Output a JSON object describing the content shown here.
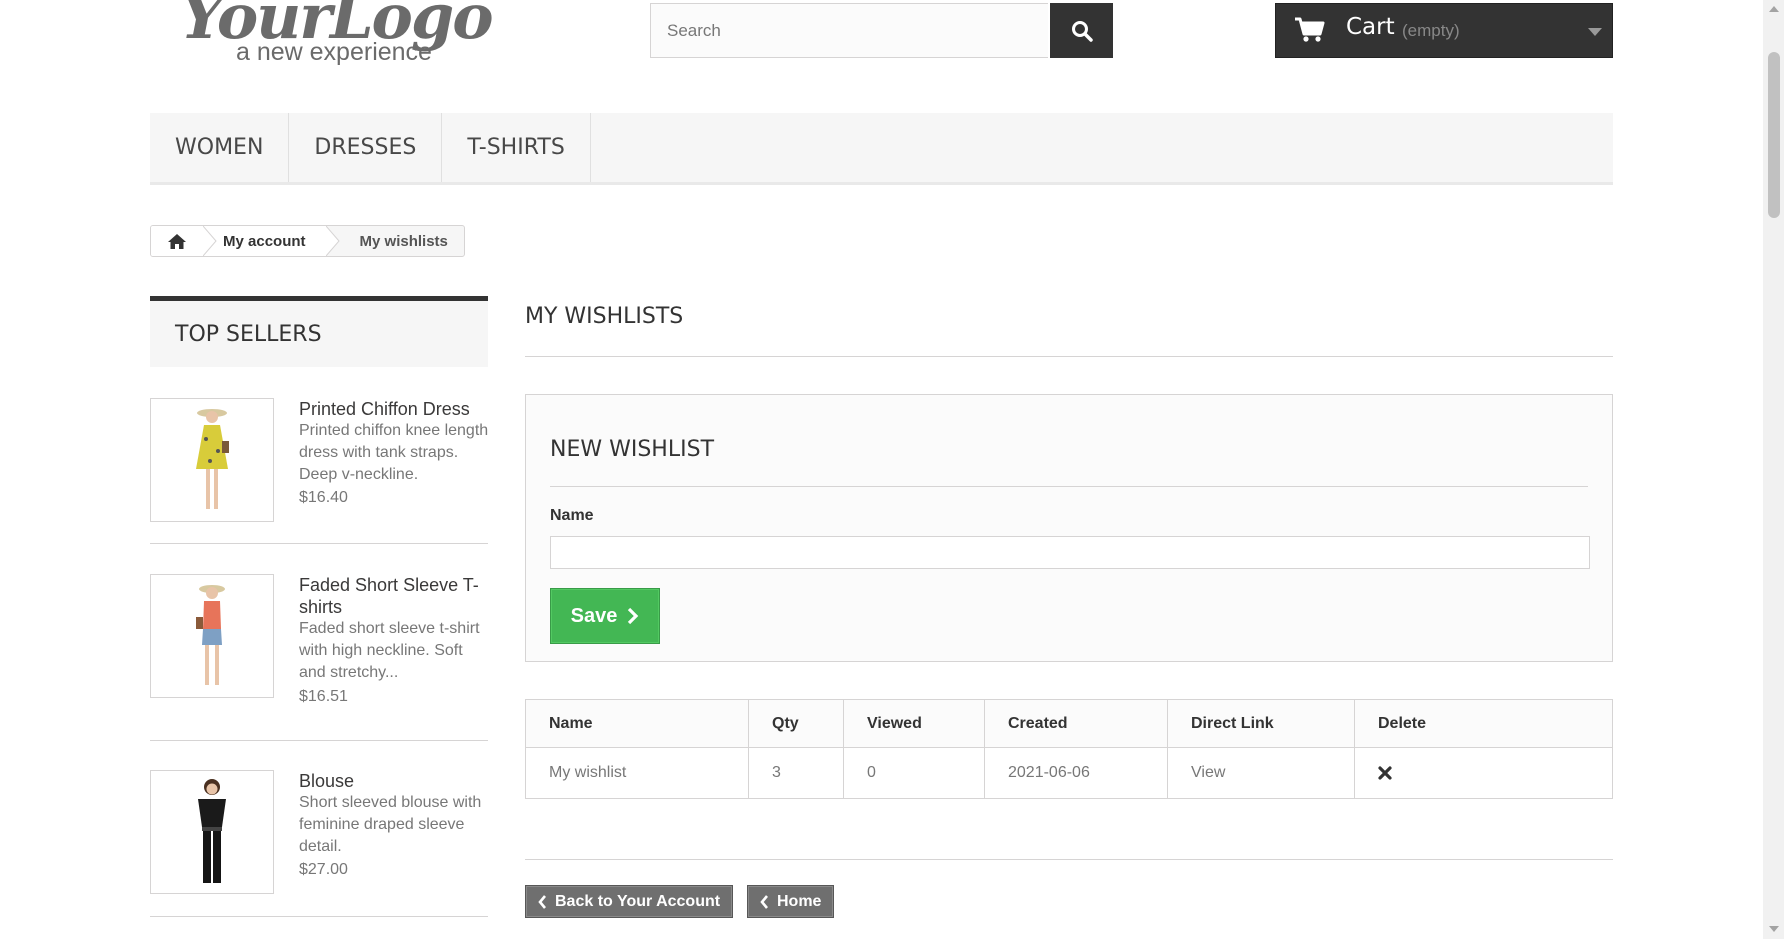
{
  "logo": {
    "main": "YourLogo",
    "tagline": "a new experience"
  },
  "search": {
    "placeholder": "Search",
    "value": ""
  },
  "cart": {
    "label": "Cart",
    "status": "(empty)"
  },
  "menu": {
    "items": [
      "WOMEN",
      "DRESSES",
      "T-SHIRTS"
    ]
  },
  "breadcrumb": {
    "account": "My account",
    "current": "My wishlists"
  },
  "sidebar": {
    "title": "TOP SELLERS",
    "products": [
      {
        "name": "Printed Chiffon Dress",
        "desc": "Printed chiffon knee length dress with tank straps. Deep v-neckline.",
        "price": "$16.40"
      },
      {
        "name": "Faded Short Sleeve T-shirts",
        "desc": "Faded short sleeve t-shirt with high neckline. Soft and stretchy...",
        "price": "$16.51"
      },
      {
        "name": "Blouse",
        "desc": "Short sleeved blouse with feminine draped sleeve detail.",
        "price": "$27.00"
      }
    ]
  },
  "main": {
    "heading": "MY WISHLISTS",
    "new_wishlist": {
      "title": "NEW WISHLIST",
      "name_label": "Name",
      "name_value": "",
      "save_label": "Save"
    },
    "table": {
      "headers": [
        "Name",
        "Qty",
        "Viewed",
        "Created",
        "Direct Link",
        "Delete"
      ],
      "rows": [
        {
          "name": "My wishlist",
          "qty": "3",
          "viewed": "0",
          "created": "2021-06-06",
          "link": "View"
        }
      ]
    },
    "back_label": "Back to Your Account",
    "home_label": "Home"
  },
  "colors": {
    "accent_green": "#43b754",
    "dark": "#333333",
    "button_gray": "#6f6f6f"
  }
}
